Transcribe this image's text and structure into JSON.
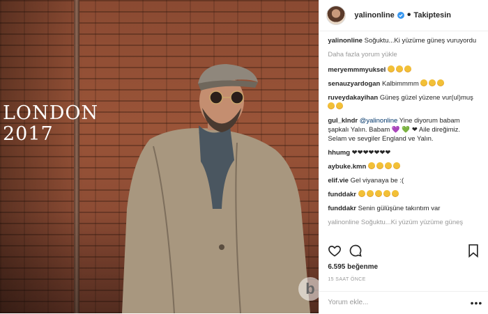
{
  "photo": {
    "overlay_text_line1": "LONDON",
    "overlay_text_line2": "2017",
    "watermark": "b"
  },
  "header": {
    "username": "yalinonline",
    "separator": "•",
    "follow_label": "Takiptesin"
  },
  "caption": {
    "user": "yalinonline",
    "text": "Soğuktu...Ki yüzüme güneş vuruyordu"
  },
  "load_more": "Daha fazla yorum yükle",
  "comments": [
    {
      "user": "meryemmmyuksel",
      "text": ""
    },
    {
      "user": "senauzyardogan",
      "text": "Kalbimmmm"
    },
    {
      "user": "ruveydakayihan",
      "text": "Güneş güzel yüzene vur(ul)muş"
    },
    {
      "user": "gul_klndr",
      "mention": "@yalinonline",
      "text": "Yine diyorum babam şapkalı Yalın. Babam 💜 💚 ❤ Aile direğimiz. Selam ve sevgiler England ve Yalın."
    },
    {
      "user": "hhumg",
      "text": "❤❤❤❤❤❤❤"
    },
    {
      "user": "aybuke.kmn",
      "text": ""
    },
    {
      "user": "elif.vie",
      "text": "Gel viyanaya be :("
    },
    {
      "user": "funddakr",
      "text": ""
    },
    {
      "user": "funddakr",
      "text": "Senin gülüşüne takıntım var"
    },
    {
      "user": "",
      "text": "yalinonline Soğuktu...Ki yüzüm yüzüme güneş"
    }
  ],
  "actions": {
    "like_icon": "heart-icon",
    "comment_icon": "comment-icon",
    "save_icon": "bookmark-icon"
  },
  "likes_text": "6.595 beğenme",
  "time_text": "15 SAAT ÖNCE",
  "add_comment": {
    "placeholder": "Yorum ekle...",
    "more": "•••"
  },
  "colors": {
    "verified": "#3897f0",
    "mention": "#003569",
    "muted": "#999999",
    "brick": "#8a4a32"
  }
}
